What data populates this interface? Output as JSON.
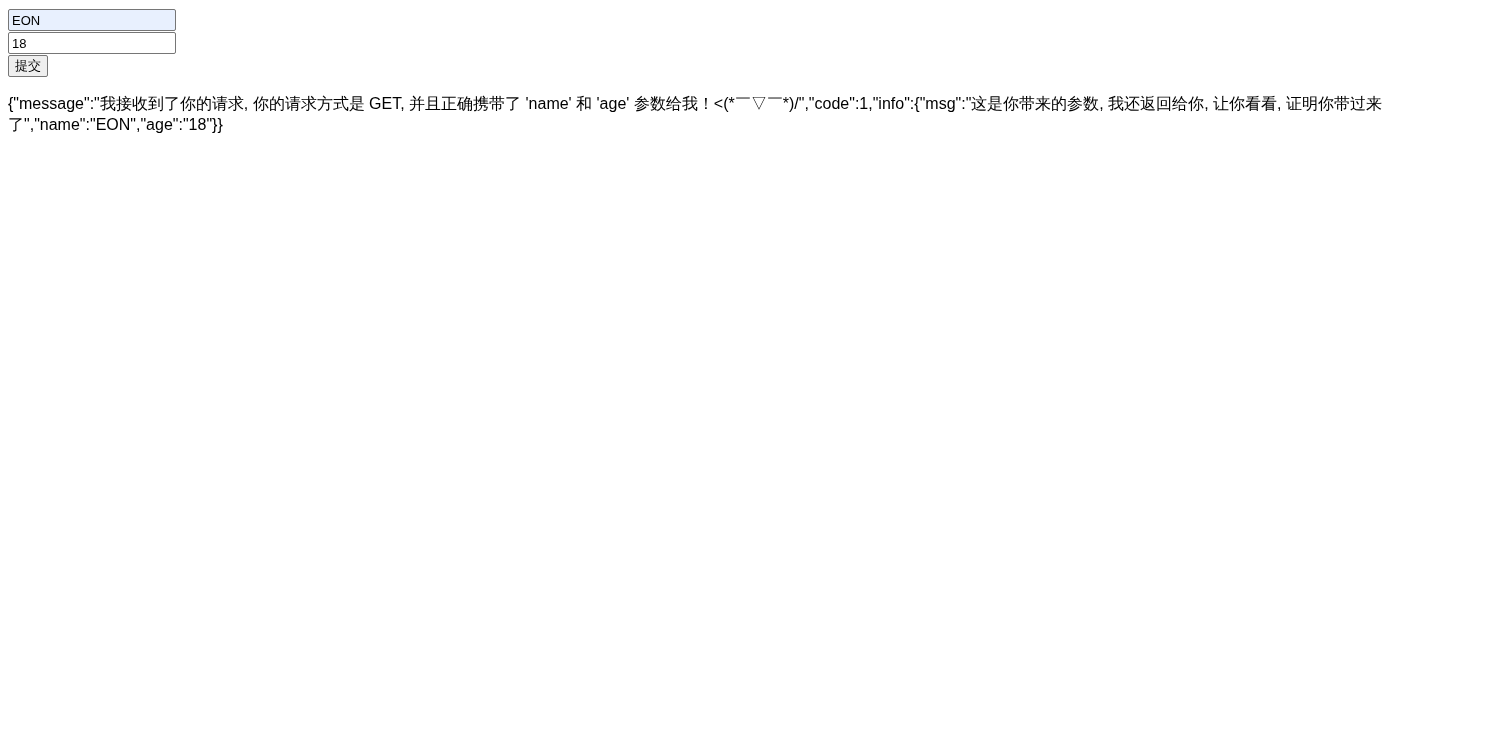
{
  "form": {
    "fields": [
      {
        "value": "EON",
        "autofilled": true
      },
      {
        "value": "18",
        "autofilled": false
      }
    ],
    "submit": "提交"
  },
  "response": "{\"message\":\"我接收到了你的请求, 你的请求方式是 GET, 并且正确携带了 'name' 和 'age' 参数给我！<(*￣▽￣*)/\",\"code\":1,\"info\":{\"msg\":\"这是你带来的参数, 我还返回给你, 让你看看, 证明你带过来了\",\"name\":\"EON\",\"age\":\"18\"}}"
}
